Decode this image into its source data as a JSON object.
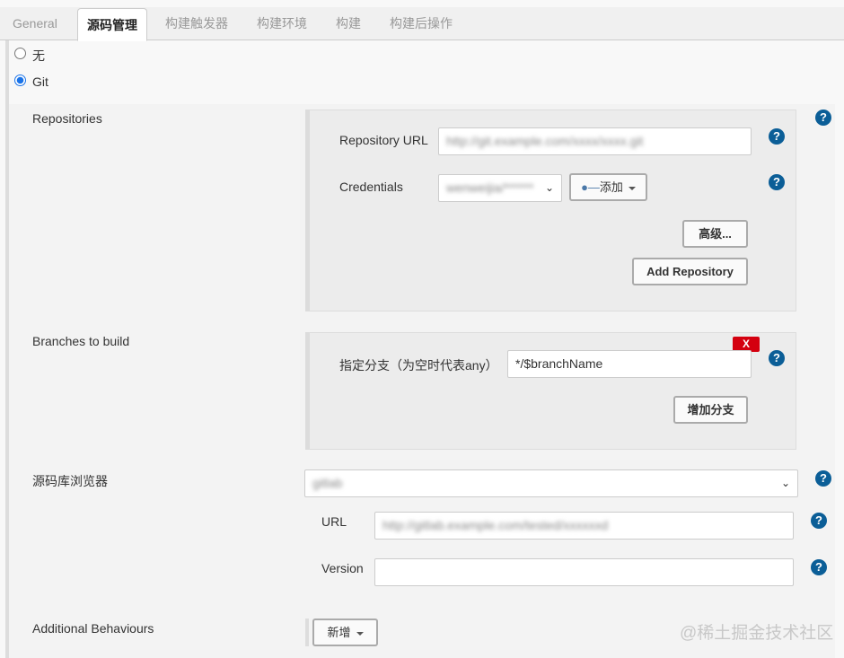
{
  "tabs": [
    {
      "label": "General"
    },
    {
      "label": "源码管理"
    },
    {
      "label": "构建触发器"
    },
    {
      "label": "构建环境"
    },
    {
      "label": "构建"
    },
    {
      "label": "构建后操作"
    }
  ],
  "scm_options": {
    "none": "无",
    "git": "Git"
  },
  "repositories": {
    "label": "Repositories",
    "url_label": "Repository URL",
    "url_value": "http://git.example.com/xxxx/xxxx.git",
    "credentials_label": "Credentials",
    "credentials_value": "wenweijia/******",
    "add_label": "添加",
    "advanced_label": "高级...",
    "add_repository_label": "Add Repository"
  },
  "branches": {
    "label": "Branches to build",
    "delete_label": "X",
    "spec_label": "指定分支（为空时代表any）",
    "spec_value": "*/$branchName",
    "add_branch_label": "增加分支"
  },
  "browser": {
    "label": "源码库浏览器",
    "selected": "gitlab",
    "url_label": "URL",
    "url_value": "http://gitlab.example.com/tested/xxxxxxd",
    "version_label": "Version",
    "version_value": ""
  },
  "additional": {
    "label": "Additional Behaviours",
    "add_label": "新增"
  },
  "help_glyph": "?",
  "watermark": "@稀土掘金技术社区"
}
